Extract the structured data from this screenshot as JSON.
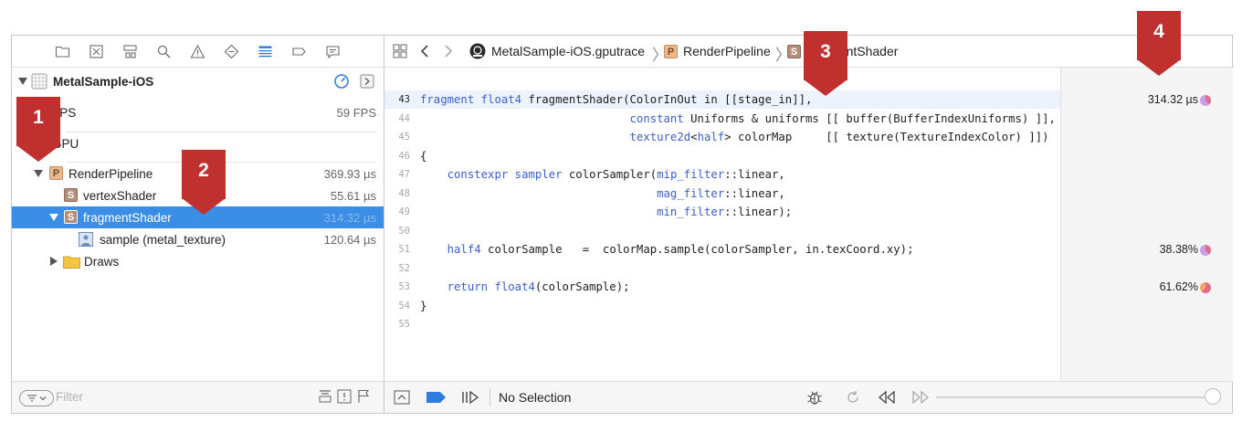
{
  "navigator": {
    "project_name": "MetalSample-iOS",
    "rows": [
      {
        "label": "FPS",
        "value": "59 FPS"
      },
      {
        "label": "GPU",
        "value": ""
      },
      {
        "label": "RenderPipeline",
        "value": "369.93 µs",
        "badge": "P"
      },
      {
        "label": "vertexShader",
        "value": "55.61 µs",
        "badge": "S"
      },
      {
        "label": "fragmentShader",
        "value": "314.32 µs",
        "badge": "S"
      },
      {
        "label": "sample (metal_texture)",
        "value": "120.64 µs"
      },
      {
        "label": "Draws",
        "value": ""
      }
    ],
    "filter_placeholder": "Filter"
  },
  "jumpbar": {
    "file": "MetalSample-iOS.gputrace",
    "pipeline": "RenderPipeline",
    "pipeline_badge": "P",
    "shader": "fragmentShader",
    "shader_badge": "S"
  },
  "code": {
    "current_line": 43,
    "lines": [
      {
        "num": "43",
        "text": "fragment float4 fragmentShader(ColorInOut in [[stage_in]],"
      },
      {
        "num": "44",
        "text": "                               constant Uniforms & uniforms [[ buffer(BufferIndexUniforms) ]],"
      },
      {
        "num": "45",
        "text": "                               texture2d<half> colorMap     [[ texture(TextureIndexColor) ]])"
      },
      {
        "num": "46",
        "text": "{"
      },
      {
        "num": "47",
        "text": "    constexpr sampler colorSampler(mip_filter::linear,"
      },
      {
        "num": "48",
        "text": "                                   mag_filter::linear,"
      },
      {
        "num": "49",
        "text": "                                   min_filter::linear);"
      },
      {
        "num": "50",
        "text": ""
      },
      {
        "num": "51",
        "text": "    half4 colorSample   =  colorMap.sample(colorSampler, in.texCoord.xy);"
      },
      {
        "num": "52",
        "text": ""
      },
      {
        "num": "53",
        "text": "    return float4(colorSample);"
      },
      {
        "num": "54",
        "text": "}"
      },
      {
        "num": "55",
        "text": ""
      }
    ]
  },
  "performance": {
    "line43": "314.32 µs",
    "line51": "38.38%",
    "line53": "61.62%"
  },
  "debugbar": {
    "selection": "No Selection"
  },
  "callouts": [
    "1",
    "2",
    "3",
    "4"
  ],
  "colors": {
    "selection": "#3a8ee6",
    "callout": "#c0302f",
    "keyword": "#3b5fd0"
  }
}
